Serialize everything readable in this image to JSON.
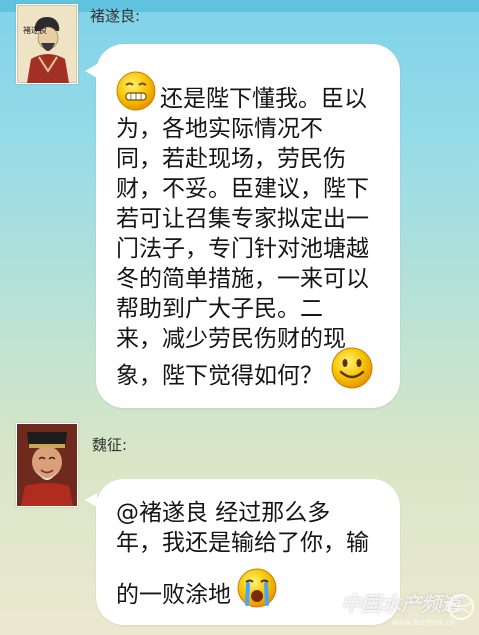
{
  "messages": [
    {
      "sender": "褚遂良:",
      "avatar_icon": "portrait-chu-suiliang-icon",
      "avatar_caption": "褚遂良",
      "lines": [
        "还是陛下懂我。臣以",
        "为，各地实际情况不",
        "同，若赴现场，劳民伤",
        "财，不妥。臣建议，陛下",
        "若可让召集专家拟定出一",
        "门法子，专门针对池塘越",
        "冬的简单措施，一来可以",
        "帮助到广大子民。二",
        "来，减少劳民伤财的现",
        "象，陛下觉得如何？"
      ],
      "emoji_start": "grin-emoji-icon",
      "emoji_end": "smile-emoji-icon"
    },
    {
      "sender": "魏征:",
      "avatar_icon": "portrait-wei-zheng-icon",
      "lines": [
        "@褚遂良 经过那么多",
        "年，我还是输给了你，输",
        "的一败涂地"
      ],
      "emoji_end": "crying-emoji-icon"
    }
  ],
  "watermark": {
    "title": "中国水产频道",
    "subtitle": "www.fishfirst.cn"
  }
}
